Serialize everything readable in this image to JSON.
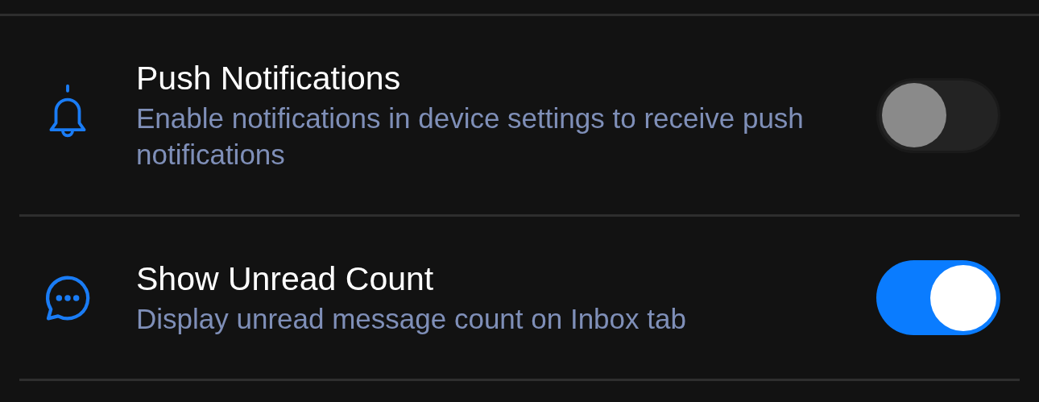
{
  "settings": [
    {
      "kind": "bell",
      "title": "Push Notifications",
      "description": "Enable notifications in device settings to receive push notifications",
      "on": false
    },
    {
      "kind": "chat",
      "title": "Show Unread Count",
      "description": "Display unread message count on Inbox tab",
      "on": true
    }
  ]
}
